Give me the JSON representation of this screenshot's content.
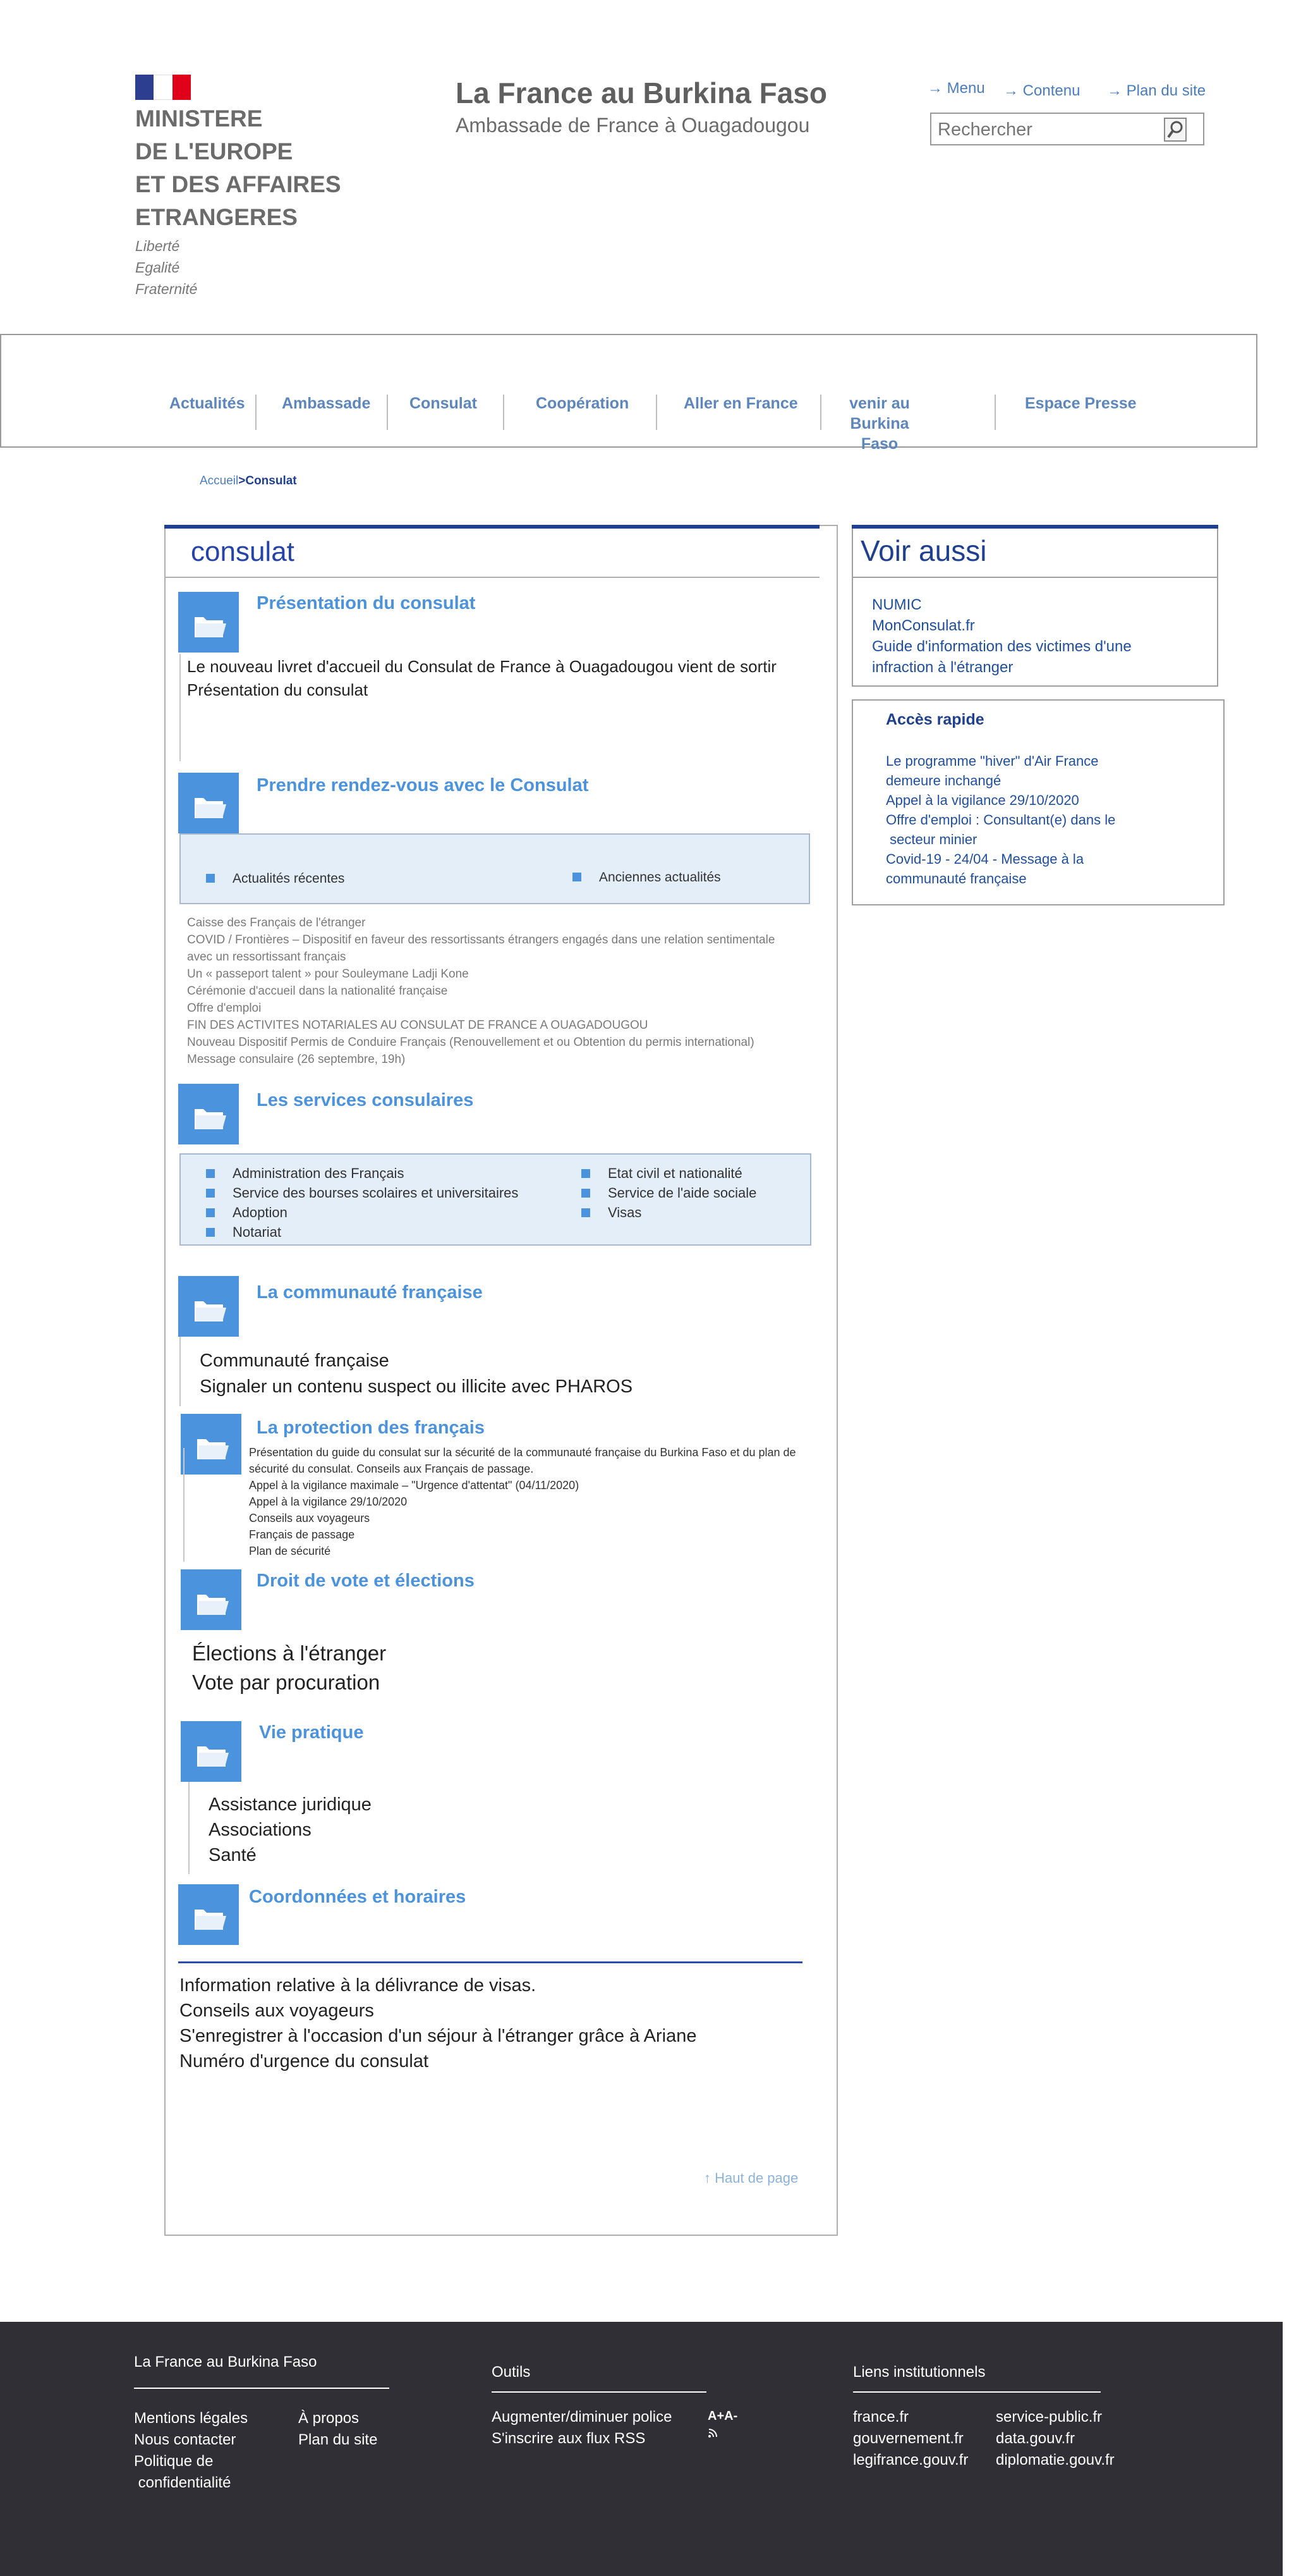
{
  "header": {
    "ministry_lines": [
      "MINISTERE",
      "DE L'EUROPE",
      "ET DES AFFAIRES",
      "ETRANGERES"
    ],
    "motto": [
      "Liberté",
      "Egalité",
      "Fraternité"
    ],
    "site_title": "La France au Burkina Faso",
    "site_subtitle": "Ambassade de France à Ouagadougou",
    "top_links": [
      "Menu",
      "Contenu",
      "Plan du site"
    ],
    "search_placeholder": "Rechercher"
  },
  "nav": {
    "items": [
      "Actualités",
      "Ambassade",
      "Consulat",
      "Coopération",
      "Aller en France",
      "venir au Burkina Faso",
      "Espace Presse"
    ]
  },
  "breadcrumb": {
    "home": "Accueil",
    "current": "Consulat"
  },
  "main": {
    "title": "consulat",
    "presentation": {
      "title": "Présentation du consulat",
      "lines": [
        "Le nouveau livret d'accueil du Consulat de France à Ouagadougou vient de sortir",
        "Présentation du consulat"
      ]
    },
    "rdv": {
      "title": "Prendre rendez-vous avec le Consulat",
      "tabs": [
        "Actualités récentes",
        "Anciennes actualités"
      ],
      "news": [
        "Caisse des Français de l'étranger",
        "COVID / Frontières – Dispositif en faveur des ressortissants étrangers engagés dans une relation sentimentale",
        "avec un ressortissant français",
        "Un « passeport talent » pour Souleymane Ladji Kone",
        "Cérémonie d'accueil dans la nationalité française",
        "Offre d'emploi",
        "FIN DES ACTIVITES NOTARIALES AU CONSULAT DE FRANCE A OUAGADOUGOU",
        "Nouveau Dispositif Permis de Conduire Français (Renouvellement et ou Obtention du permis international)",
        "Message consulaire (26 septembre, 19h)"
      ]
    },
    "services": {
      "title": "Les services consulaires",
      "left": [
        "Administration des Français",
        "Service des bourses scolaires et universitaires",
        "Adoption",
        "Notariat"
      ],
      "right": [
        "Etat civil et nationalité",
        "Service de l'aide sociale",
        "Visas"
      ]
    },
    "communaute": {
      "title": "La communauté française",
      "lines": [
        "Communauté française",
        "Signaler un contenu suspect ou illicite avec PHAROS"
      ]
    },
    "protection": {
      "title": "La protection des français",
      "lines": [
        "Présentation du guide du consulat sur la sécurité de la communauté française du Burkina Faso et du plan de",
        "sécurité du consulat. Conseils aux Français de passage.",
        "Appel à la vigilance maximale – \"Urgence d'attentat\" (04/11/2020)",
        "Appel à la vigilance 29/10/2020",
        "Conseils aux voyageurs",
        "Français de passage",
        "Plan de sécurité"
      ]
    },
    "vote": {
      "title": "Droit de vote et élections",
      "lines": [
        "Élections à l'étranger",
        "Vote par procuration"
      ]
    },
    "vie": {
      "title": "Vie pratique",
      "lines": [
        "Assistance juridique",
        "Associations",
        "Santé"
      ]
    },
    "coordonnees": {
      "title": "Coordonnées et horaires",
      "lines": [
        "Information relative à la délivrance de visas.",
        "Conseils aux voyageurs",
        "S'enregistrer à l'occasion d'un séjour à l'étranger grâce à Ariane",
        "Numéro d'urgence du consulat"
      ]
    },
    "back_to_top": "Haut de page"
  },
  "aside": {
    "voir_aussi": {
      "title": "Voir aussi",
      "links": [
        "NUMIC",
        "MonConsulat.fr",
        "Guide d'information des victimes d'une",
        "infraction à l'étranger"
      ]
    },
    "acces_rapide": {
      "title": "Accès rapide",
      "links": [
        "Le programme \"hiver\" d'Air France",
        "demeure inchangé",
        "Appel à la vigilance 29/10/2020",
        "Offre d'emploi : Consultant(e) dans le",
        " secteur minier",
        "Covid-19 - 24/04 - Message à la",
        "communauté française"
      ]
    }
  },
  "footer": {
    "col1": {
      "title": "La France au Burkina Faso",
      "left": [
        "Mentions légales",
        "Nous contacter",
        "Politique de",
        " confidentialité"
      ],
      "right": [
        "À propos",
        "Plan du site"
      ]
    },
    "col2": {
      "title": "Outils",
      "links": [
        "Augmenter/diminuer police",
        "S'inscrire aux flux RSS"
      ],
      "font_icon_label": "A+A-"
    },
    "col3": {
      "title": "Liens institutionnels",
      "left": [
        "france.fr",
        "gouvernement.fr",
        "legifrance.gouv.fr"
      ],
      "right": [
        "service-public.fr",
        "data.gouv.fr",
        "diplomatie.gouv.fr"
      ]
    }
  },
  "colors": {
    "accent": "#4c93dd",
    "navy": "#1f3f8f",
    "footer_bg": "#2f2f35",
    "highlight_box": "#e3eef9"
  }
}
